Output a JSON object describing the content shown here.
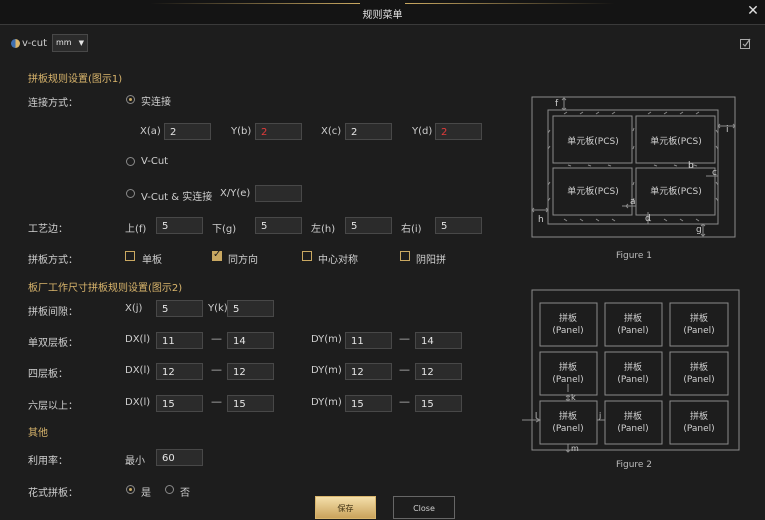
{
  "window": {
    "title": "规则菜单"
  },
  "toolbar": {
    "vcut_label": "v-cut",
    "unit_value": "mm"
  },
  "section1": {
    "title": "拼板规则设置(图示1)",
    "connect_label": "连接方式：",
    "solid_label": "实连接",
    "xa_label": "X(a)",
    "xa_value": "2",
    "yb_label": "Y(b)",
    "yb_value": "2",
    "xc_label": "X(c)",
    "xc_value": "2",
    "yd_label": "Y(d)",
    "yd_value": "2",
    "vcut_label": "V-Cut",
    "vcut_solid_label": "V-Cut & 实连接",
    "xye_label": "X/Y(e)",
    "xye_value": "",
    "edge_label": "工艺边：",
    "top_label": "上(f)",
    "top_value": "5",
    "bottom_label": "下(g)",
    "bottom_value": "5",
    "left_label": "左(h)",
    "left_value": "5",
    "right_label": "右(i)",
    "right_value": "5",
    "panel_mode_label": "拼板方式：",
    "opt_single": "单板",
    "opt_same": "同方向",
    "opt_center": "中心对称",
    "opt_yinyang": "阴阳拼"
  },
  "section2": {
    "title": "板厂工作尺寸拼板规则设置(图示2)",
    "gap_label": "拼板间隙：",
    "xj_label": "X(j)",
    "xj_value": "5",
    "yk_label": "Y(k)",
    "yk_value": "5",
    "rows": [
      {
        "label": "单双层板：",
        "dx_label": "DX(l)",
        "dx_min": "11",
        "dx_max": "14",
        "dy_label": "DY(m)",
        "dy_min": "11",
        "dy_max": "14"
      },
      {
        "label": "四层板：",
        "dx_label": "DX(l)",
        "dx_min": "12",
        "dx_max": "12",
        "dy_label": "DY(m)",
        "dy_min": "12",
        "dy_max": "12"
      },
      {
        "label": "六层以上：",
        "dx_label": "DX(l)",
        "dx_min": "15",
        "dx_max": "15",
        "dy_label": "DY(m)",
        "dy_min": "15",
        "dy_max": "15"
      }
    ],
    "dash": "—"
  },
  "section3": {
    "title": "其他",
    "util_label": "利用率：",
    "min_label": "最小",
    "util_value": "60",
    "fancy_label": "花式拼板：",
    "yes_label": "是",
    "no_label": "否"
  },
  "figure1": {
    "caption": "Figure 1",
    "cell": "单元板(PCS)",
    "labels": {
      "a": "a",
      "b": "b",
      "c": "c",
      "d": "d",
      "f": "f",
      "g": "g",
      "h": "h",
      "i": "i"
    }
  },
  "figure2": {
    "caption": "Figure 2",
    "cell_line1": "拼板",
    "cell_line2": "(Panel)",
    "labels": {
      "k": "k",
      "l": "l",
      "j": "j",
      "m": "m"
    }
  },
  "buttons": {
    "save": "保存",
    "close": "Close"
  },
  "colors": {
    "accent": "#c9a861",
    "red": "#e23b3b",
    "background": "#1d1d1d"
  }
}
